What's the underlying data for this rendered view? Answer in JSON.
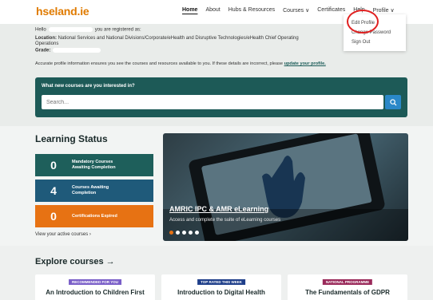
{
  "header": {
    "logo": "hseland.ie",
    "nav": {
      "home": "Home",
      "about": "About",
      "hubs": "Hubs & Resources",
      "courses": "Courses ∨",
      "certificates": "Certificates",
      "help": "Help",
      "profile": "Profile ∨"
    },
    "dropdown": {
      "edit_profile": "Edit Profile",
      "change_password": "Change Password",
      "sign_out": "Sign Out"
    }
  },
  "registration": {
    "hello": "Hello",
    "registered_as": "you are registered as:",
    "location_label": "Location:",
    "location_value": "National Services and National Divisions/Corporate/eHealth and Disruptive Technologies/eHealth Chief Operating",
    "location_cont": "Operations",
    "grade_label": "Grade:",
    "accuracy_text": "Accurate profile information ensures you see the courses and resources available to you. If these details are incorrect, please",
    "update_link": "update your profile."
  },
  "search": {
    "question": "What new courses are you interested in?",
    "placeholder": "Search..."
  },
  "learning_status": {
    "title": "Learning Status",
    "mandatory": {
      "count": "0",
      "label_line1": "Mandatory Courses",
      "label_line2": "Awaiting Completion"
    },
    "awaiting": {
      "count": "4",
      "label_line1": "Courses Awaiting",
      "label_line2": "Completion"
    },
    "certifications": {
      "count": "0",
      "label_line1": "Certifications Expired"
    },
    "view_active": "View your active courses ›"
  },
  "promo": {
    "title": "AMRIC IPC & AMR eLearning",
    "subtitle": "Access and complete the suite of eLearning courses"
  },
  "explore": {
    "title": "Explore courses →",
    "cards": [
      {
        "badge": "RECOMMENDED FOR YOU",
        "badge_color": "#7a5fc8",
        "title": "An Introduction to Children First"
      },
      {
        "badge": "TOP RATED THIS WEEK",
        "badge_color": "#1f3f8a",
        "title": "Introduction to Digital Health"
      },
      {
        "badge": "NATIONAL PROGRAMME",
        "badge_color": "#9a2a5a",
        "title": "The Fundamentals of GDPR"
      }
    ]
  },
  "colors": {
    "brand_orange": "#e07b00",
    "teal": "#1d5a57",
    "blue": "#1f5a7a",
    "orange": "#e77213",
    "highlight": "#e02020"
  },
  "icons": {
    "search": "search-icon"
  }
}
